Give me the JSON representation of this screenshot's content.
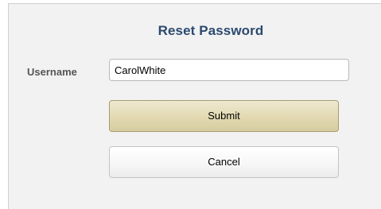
{
  "dialog": {
    "title": "Reset Password",
    "username_label": "Username",
    "username_value": "CarolWhite",
    "submit_label": "Submit",
    "cancel_label": "Cancel"
  }
}
